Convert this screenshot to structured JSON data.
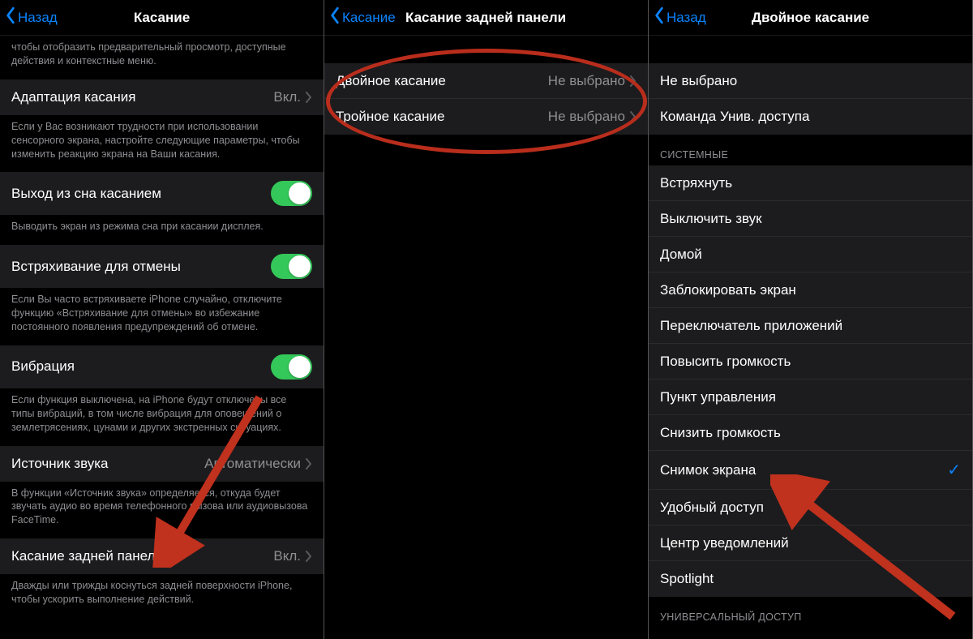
{
  "screen1": {
    "back": "Назад",
    "title": "Касание",
    "intro_footer": "чтобы отобразить предварительный просмотр, доступные действия и контекстные меню.",
    "touch_accom": {
      "label": "Адаптация касания",
      "value": "Вкл."
    },
    "touch_accom_footer": "Если у Вас возникают трудности при использовании сенсорного экрана, настройте следующие параметры, чтобы изменить реакцию экрана на Ваши касания.",
    "tap_wake": {
      "label": "Выход из сна касанием"
    },
    "tap_wake_footer": "Выводить экран из режима сна при касании дисплея.",
    "shake_undo": {
      "label": "Встряхивание для отмены"
    },
    "shake_undo_footer": "Если Вы часто встряхиваете iPhone случайно, отключите функцию «Встряхивание для отмены» во избежание постоянного появления предупреждений об отмене.",
    "vibration": {
      "label": "Вибрация"
    },
    "vibration_footer": "Если функция выключена, на iPhone будут отключены все типы вибраций, в том числе вибрация для оповещений о землетрясениях, цунами и других экстренных ситуациях.",
    "audio_route": {
      "label": "Источник звука",
      "value": "Автоматически"
    },
    "audio_route_footer": "В функции «Источник звука» определяется, откуда будет звучать аудио во время телефонного вызова или аудиовызова FaceTime.",
    "back_tap": {
      "label": "Касание задней панели",
      "value": "Вкл."
    },
    "back_tap_footer": "Дважды или трижды коснуться задней поверхности iPhone, чтобы ускорить выполнение действий."
  },
  "screen2": {
    "back": "Касание",
    "title": "Касание задней панели",
    "double": {
      "label": "Двойное касание",
      "value": "Не выбрано"
    },
    "triple": {
      "label": "Тройное касание",
      "value": "Не выбрано"
    }
  },
  "screen3": {
    "back": "Назад",
    "title": "Двойное касание",
    "none": "Не выбрано",
    "ua_command": "Команда Унив. доступа",
    "system_header": "СИСТЕМНЫЕ",
    "system_items": [
      "Встряхнуть",
      "Выключить звук",
      "Домой",
      "Заблокировать экран",
      "Переключатель приложений",
      "Повысить громкость",
      "Пункт управления",
      "Снизить громкость",
      "Снимок экрана",
      "Удобный доступ",
      "Центр уведомлений",
      "Spotlight"
    ],
    "selected_index": 8,
    "access_header": "УНИВЕРСАЛЬНЫЙ ДОСТУП"
  }
}
